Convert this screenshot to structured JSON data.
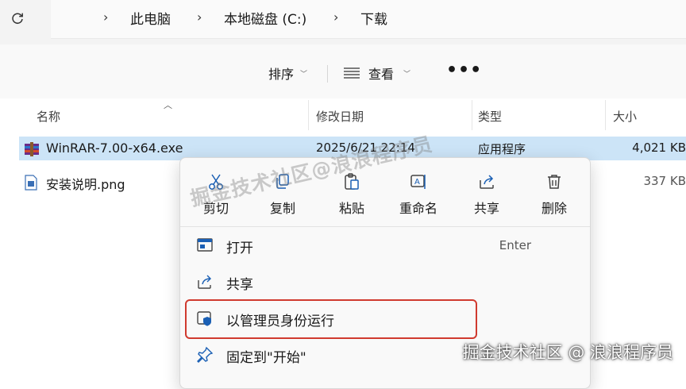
{
  "address_bar": {
    "breadcrumbs": [
      "此电脑",
      "本地磁盘 (C:)",
      "下载"
    ]
  },
  "toolbar": {
    "sort_label": "排序",
    "view_label": "查看",
    "more_label": "•••"
  },
  "columns": {
    "name": "名称",
    "date": "修改日期",
    "type": "类型",
    "size": "大小"
  },
  "files": [
    {
      "name": "WinRAR-7.00-x64.exe",
      "date": "2025/6/21 22:14",
      "type": "应用程序",
      "size": "4,021 KB",
      "selected": true
    },
    {
      "name": "安装说明.png",
      "size": "337 KB",
      "selected": false
    }
  ],
  "context_menu": {
    "actions": [
      {
        "label": "剪切",
        "icon": "cut-icon"
      },
      {
        "label": "复制",
        "icon": "copy-icon"
      },
      {
        "label": "粘贴",
        "icon": "paste-icon"
      },
      {
        "label": "重命名",
        "icon": "rename-icon"
      },
      {
        "label": "共享",
        "icon": "share-icon"
      },
      {
        "label": "删除",
        "icon": "delete-icon"
      }
    ],
    "items": [
      {
        "label": "打开",
        "shortcut": "Enter",
        "icon": "open-icon"
      },
      {
        "label": "共享",
        "icon": "share-icon"
      },
      {
        "label": "以管理员身份运行",
        "icon": "shield-icon",
        "highlighted": true
      },
      {
        "label": "固定到\"开始\"",
        "icon": "pin-icon"
      }
    ]
  },
  "watermark": {
    "diagonal": "掘金技术社区@浪浪程序员",
    "corner": "掘金技术社区 @ 浪浪程序员"
  },
  "colors": {
    "selection": "#cce4f7",
    "highlight_border": "#d03a2f",
    "icon_blue": "#1a5fb4"
  }
}
